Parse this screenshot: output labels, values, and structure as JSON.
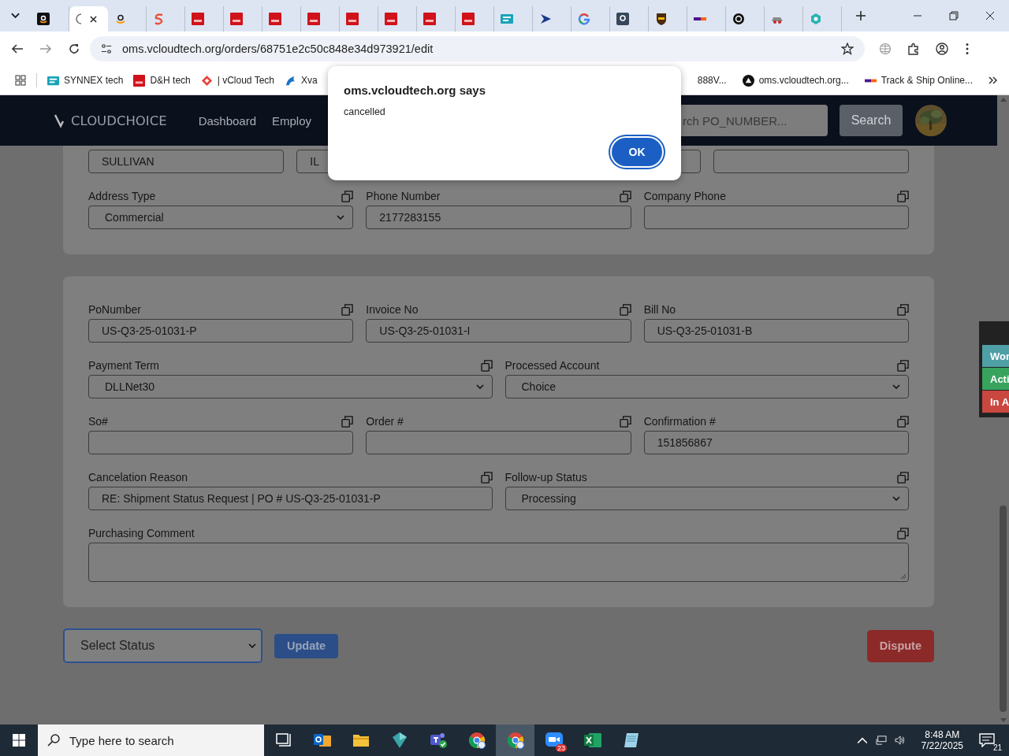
{
  "browser": {
    "tabs": [
      {
        "kind": "amazon",
        "selected": false
      },
      {
        "kind": "blank",
        "selected": true
      },
      {
        "kind": "amazon-light",
        "selected": false
      },
      {
        "kind": "swirl",
        "selected": false
      },
      {
        "kind": "dh",
        "selected": false
      },
      {
        "kind": "dh",
        "selected": false
      },
      {
        "kind": "dh",
        "selected": false
      },
      {
        "kind": "dh",
        "selected": false
      },
      {
        "kind": "dh",
        "selected": false
      },
      {
        "kind": "dh",
        "selected": false
      },
      {
        "kind": "dh",
        "selected": false
      },
      {
        "kind": "dh",
        "selected": false
      },
      {
        "kind": "ec",
        "selected": false
      },
      {
        "kind": "play",
        "selected": false
      },
      {
        "kind": "google",
        "selected": false
      },
      {
        "kind": "amazon-dark",
        "selected": false
      },
      {
        "kind": "ups",
        "selected": false
      },
      {
        "kind": "fedex",
        "selected": false
      },
      {
        "kind": "ring",
        "selected": false
      },
      {
        "kind": "car",
        "selected": false
      },
      {
        "kind": "hex",
        "selected": false
      }
    ],
    "url": "oms.vcloudtech.org/orders/68751e2c50c848e34d973921/edit",
    "bookmarks_left": [
      {
        "kind": "ec",
        "label": "SYNNEX tech"
      },
      {
        "kind": "dh",
        "label": "D&H tech"
      },
      {
        "kind": "diamond",
        "label": "| vCloud Tech"
      },
      {
        "kind": "bird",
        "label": "Xva"
      }
    ],
    "bookmarks_right": [
      {
        "kind": "none",
        "label": "888V..."
      },
      {
        "kind": "triangle",
        "label": "oms.vcloudtech.org..."
      },
      {
        "kind": "fedex",
        "label": "Track & Ship Online..."
      }
    ]
  },
  "header": {
    "logo": "CLOUDCHOICE",
    "nav": [
      "Dashboard",
      "Employ"
    ],
    "search": {
      "placeholder": "rch PO_NUMBER..."
    },
    "search_button": "Search"
  },
  "address_card": {
    "rows": [
      {
        "fields": [
          {
            "kind": "input",
            "value": "SULLIVAN"
          },
          {
            "kind": "input",
            "value": "IL"
          },
          {
            "kind": "input"
          },
          {
            "kind": "input"
          }
        ]
      },
      {
        "fields": [
          {
            "kind": "select",
            "label": "Address Type",
            "value": "Commercial"
          },
          {
            "kind": "input",
            "label": "Phone Number",
            "value": "2177283155"
          },
          {
            "kind": "input",
            "label": "Company Phone"
          }
        ]
      }
    ]
  },
  "order_card": {
    "rows": [
      {
        "fields": [
          {
            "kind": "input",
            "label": "PoNumber",
            "value": "US-Q3-25-01031-P"
          },
          {
            "kind": "input",
            "label": "Invoice No",
            "value": "US-Q3-25-01031-I"
          },
          {
            "kind": "input",
            "label": "Bill No",
            "value": "US-Q3-25-01031-B"
          }
        ]
      },
      {
        "fields": [
          {
            "kind": "select",
            "label": "Payment Term",
            "value": "DLLNet30"
          },
          {
            "kind": "select",
            "label": "Processed Account",
            "value": "Choice"
          }
        ]
      },
      {
        "fields": [
          {
            "kind": "input",
            "label": "So#"
          },
          {
            "kind": "input",
            "label": "Order #"
          },
          {
            "kind": "input",
            "label": "Confirmation #",
            "value": "151856867"
          }
        ]
      },
      {
        "fields": [
          {
            "kind": "input",
            "label": "Cancelation Reason",
            "value": "RE: Shipment Status Request | PO # US-Q3-25-01031-P"
          },
          {
            "kind": "select",
            "label": "Follow-up Status",
            "value": "Processing"
          }
        ]
      },
      {
        "fields": [
          {
            "kind": "textarea",
            "label": "Purchasing Comment"
          }
        ]
      }
    ]
  },
  "actions": {
    "status_select": "Select Status",
    "update": "Update",
    "dispute": "Dispute"
  },
  "side_panel": [
    {
      "label": "Wor",
      "color": "#4f9fa6"
    },
    {
      "label": "Acti",
      "color": "#37a35d"
    },
    {
      "label": "In A",
      "color": "#c9473f"
    }
  ],
  "dialog": {
    "title": "oms.vcloudtech.org says",
    "message": "cancelled",
    "button": "OK"
  },
  "taskbar": {
    "search": {
      "placeholder": "Type here to search"
    },
    "apps": [
      {
        "kind": "taskview",
        "active": false
      },
      {
        "kind": "outlook",
        "active": false
      },
      {
        "kind": "folder",
        "active": false
      },
      {
        "kind": "gem",
        "active": false
      },
      {
        "kind": "teams",
        "active": false
      },
      {
        "kind": "chrome",
        "active": false
      },
      {
        "kind": "chrome",
        "active": true
      },
      {
        "kind": "zoom",
        "active": false,
        "badge": "23"
      },
      {
        "kind": "excel",
        "active": false
      },
      {
        "kind": "notepad",
        "active": false
      }
    ],
    "time": "8:48 AM",
    "date": "7/22/2025",
    "notifications": "21"
  }
}
